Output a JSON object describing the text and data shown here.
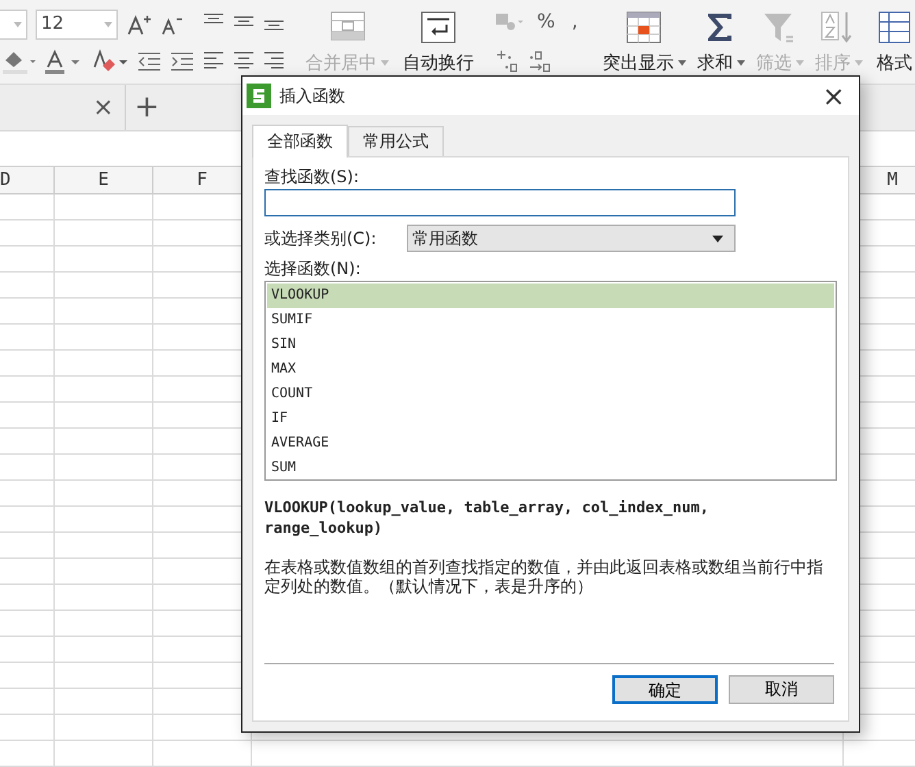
{
  "ribbon": {
    "font_size": "12",
    "buttons": [
      {
        "kind": "merge",
        "label": "合并居中",
        "disabled": true,
        "dropdown": true
      },
      {
        "kind": "wrap",
        "label": "自动换行",
        "disabled": false,
        "dropdown": false
      },
      {
        "kind": "highlight",
        "label": "突出显示",
        "disabled": false,
        "dropdown": true
      },
      {
        "kind": "sum",
        "label": "求和",
        "disabled": false,
        "dropdown": true
      },
      {
        "kind": "filter",
        "label": "筛选",
        "disabled": true,
        "dropdown": true
      },
      {
        "kind": "sort",
        "label": "排序",
        "disabled": true,
        "dropdown": true
      },
      {
        "kind": "format",
        "label": "格式",
        "disabled": false,
        "dropdown": false
      }
    ],
    "number_symbols": [
      "%",
      ","
    ]
  },
  "tab_bar": {
    "close": "×",
    "add": "+"
  },
  "sheet": {
    "columns": [
      "D",
      "E",
      "F",
      "M"
    ]
  },
  "dialog": {
    "title": "插入函数",
    "close": "×",
    "tabs": [
      {
        "label": "全部函数",
        "selected": true
      },
      {
        "label": "常用公式",
        "selected": false
      }
    ],
    "search": {
      "label": "查找函数(S):"
    },
    "category": {
      "label": "或选择类别(C):",
      "value": "常用函数"
    },
    "list_label": "选择函数(N):",
    "functions": [
      {
        "name": "VLOOKUP",
        "selected": true
      },
      {
        "name": "SUMIF",
        "selected": false
      },
      {
        "name": "SIN",
        "selected": false
      },
      {
        "name": "MAX",
        "selected": false
      },
      {
        "name": "COUNT",
        "selected": false
      },
      {
        "name": "IF",
        "selected": false
      },
      {
        "name": "AVERAGE",
        "selected": false
      },
      {
        "name": "SUM",
        "selected": false
      }
    ],
    "syntax": "VLOOKUP(lookup_value, table_array, col_index_num, range_lookup)",
    "description": "在表格或数值数组的首列查找指定的数值，并由此返回表格或数组当前行中指定列处的数值。（默认情况下，表是升序的）",
    "buttons": [
      {
        "label": "确定",
        "default": true
      },
      {
        "label": "取消",
        "default": false
      }
    ]
  }
}
